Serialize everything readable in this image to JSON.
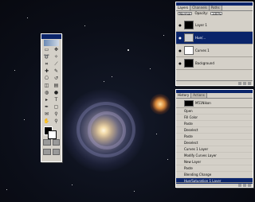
{
  "layers_palette": {
    "tabs": [
      "Layers",
      "Channels",
      "Paths"
    ],
    "blend_mode": "Normal",
    "opacity_label": "Opacity:",
    "opacity_value": "100%",
    "layers": [
      {
        "name": "Layer 1",
        "thumb": "#000000",
        "selected": false
      },
      {
        "name": "Hue/...",
        "thumb": "#d0d0d0",
        "selected": true
      },
      {
        "name": "Curves 1",
        "thumb": "#ffffff",
        "selected": false
      },
      {
        "name": "Background",
        "thumb": "#000000",
        "selected": false
      }
    ]
  },
  "history_palette": {
    "tabs": [
      "History",
      "Actions"
    ],
    "snapshot": "M51Nikon",
    "items": [
      {
        "label": "Open",
        "selected": false
      },
      {
        "label": "Fill Color",
        "selected": false
      },
      {
        "label": "Paste",
        "selected": false
      },
      {
        "label": "Deselect",
        "selected": false
      },
      {
        "label": "Paste",
        "selected": false
      },
      {
        "label": "Deselect",
        "selected": false
      },
      {
        "label": "Curves 1 Layer",
        "selected": false
      },
      {
        "label": "Modify Curves Layer",
        "selected": false
      },
      {
        "label": "New Layer",
        "selected": false
      },
      {
        "label": "Paste",
        "selected": false
      },
      {
        "label": "Blending Change",
        "selected": false
      },
      {
        "label": "Hue/Saturation 1 Layer",
        "selected": true
      }
    ]
  },
  "tools": [
    "marquee-icon",
    "move-icon",
    "lasso-icon",
    "magic-wand-icon",
    "crop-icon",
    "slice-icon",
    "healing-icon",
    "brush-icon",
    "stamp-icon",
    "history-brush-icon",
    "eraser-icon",
    "gradient-icon",
    "blur-icon",
    "dodge-icon",
    "path-select-icon",
    "type-icon",
    "pen-icon",
    "shape-icon",
    "notes-icon",
    "eyedropper-icon",
    "hand-icon",
    "zoom-icon"
  ],
  "colors": {
    "foreground": "#000000",
    "background": "#ffffff",
    "title_bar": "#0a246a"
  }
}
